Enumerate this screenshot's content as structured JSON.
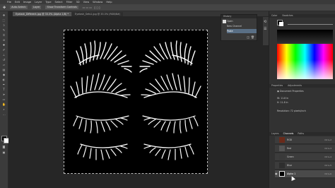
{
  "menubar": {
    "items": [
      "File",
      "Edit",
      "Image",
      "Layer",
      "Type",
      "Select",
      "Filter",
      "3D",
      "View",
      "Window",
      "Help"
    ]
  },
  "options": {
    "auto_select": "Auto-Select:",
    "layer": "Layer",
    "transform": "Show Transform Controls"
  },
  "tabs": [
    {
      "label": "Eyelash_Different.jpg @ 33.3% (Alpha 1/8) *"
    },
    {
      "label": "Eyelash_Sets1.jpg @ 33.3% (RGB/8#)"
    }
  ],
  "history": {
    "title": "History",
    "items": [
      "Open",
      "New Channel",
      "Paste"
    ]
  },
  "color": {
    "title": "Color",
    "swatches_tab": "Swatches",
    "accent": "#c21a12"
  },
  "properties": {
    "tab": "Properties",
    "adjust_tab": "Adjustments",
    "doc_title": "Document Properties",
    "w_label": "W:",
    "w_value": "11.8 in",
    "h_label": "H:",
    "h_value": "11.8 in",
    "res_label": "Resolution:",
    "res_value": "72 pixels/inch"
  },
  "channels": {
    "tabs": [
      "Layers",
      "Channels",
      "Paths"
    ],
    "rows": [
      {
        "name": "RGB",
        "shortcut": "Ctrl+2"
      },
      {
        "name": "Red",
        "shortcut": "Ctrl+3"
      },
      {
        "name": "Green",
        "shortcut": "Ctrl+4"
      },
      {
        "name": "Blue",
        "shortcut": "Ctrl+5"
      },
      {
        "name": "Alpha 1",
        "shortcut": "Ctrl+6"
      }
    ]
  }
}
